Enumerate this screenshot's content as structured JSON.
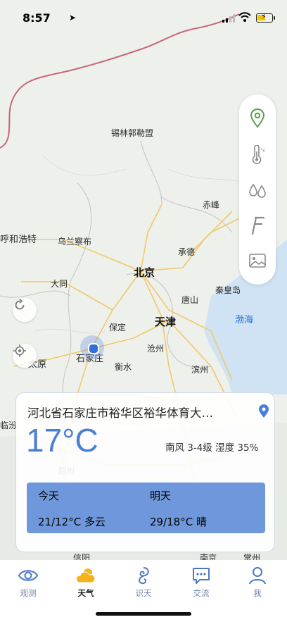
{
  "status_bar": {
    "time": "8:57"
  },
  "map": {
    "cities": [
      {
        "name": "锡林郭勒盟",
        "style": "normal"
      },
      {
        "name": "乌兰察布",
        "style": "normal"
      },
      {
        "name": "呼和浩特",
        "style": "normal"
      },
      {
        "name": "赤峰",
        "style": "normal"
      },
      {
        "name": "承德",
        "style": "normal"
      },
      {
        "name": "北京",
        "style": "big"
      },
      {
        "name": "大同",
        "style": "normal"
      },
      {
        "name": "秦皇岛",
        "style": "normal"
      },
      {
        "name": "唐山",
        "style": "normal"
      },
      {
        "name": "渤海",
        "style": "blue"
      },
      {
        "name": "保定",
        "style": "normal"
      },
      {
        "name": "天津",
        "style": "big"
      },
      {
        "name": "沧州",
        "style": "normal"
      },
      {
        "name": "石家庄",
        "style": "normal"
      },
      {
        "name": "太原",
        "style": "normal"
      },
      {
        "name": "衡水",
        "style": "normal"
      },
      {
        "name": "滨州",
        "style": "normal"
      },
      {
        "name": "临汾",
        "style": "normal"
      },
      {
        "name": "郑州",
        "style": "normal"
      },
      {
        "name": "信阳",
        "style": "normal"
      },
      {
        "name": "南京",
        "style": "normal"
      },
      {
        "name": "常州",
        "style": "normal"
      }
    ]
  },
  "layers": [
    {
      "icon": "location-pin-icon"
    },
    {
      "icon": "thermometer-icon"
    },
    {
      "icon": "precipitation-icon"
    },
    {
      "icon": "wind-layer-icon"
    },
    {
      "icon": "image-layer-icon"
    }
  ],
  "weather_card": {
    "address": "河北省石家庄市裕华区裕华体育大…",
    "temperature": "17°C",
    "wind_humidity": "南风 3-4级 湿度 35%",
    "forecast": [
      {
        "day": "今天",
        "detail": "21/12°C 多云"
      },
      {
        "day": "明天",
        "detail": "29/18°C 晴"
      }
    ]
  },
  "tabs": [
    {
      "label": "观测",
      "icon": "eye-icon",
      "active": false
    },
    {
      "label": "天气",
      "icon": "cloud-sun-icon",
      "active": true
    },
    {
      "label": "识天",
      "icon": "identify-weather-icon",
      "active": false
    },
    {
      "label": "交流",
      "icon": "chat-icon",
      "active": false
    },
    {
      "label": "我",
      "icon": "person-icon",
      "active": false
    }
  ],
  "colors": {
    "accent": "#4a7fd6",
    "forecast_bg": "#6f98dc",
    "border_line": "#c9667a",
    "road": "#f0c96a"
  }
}
